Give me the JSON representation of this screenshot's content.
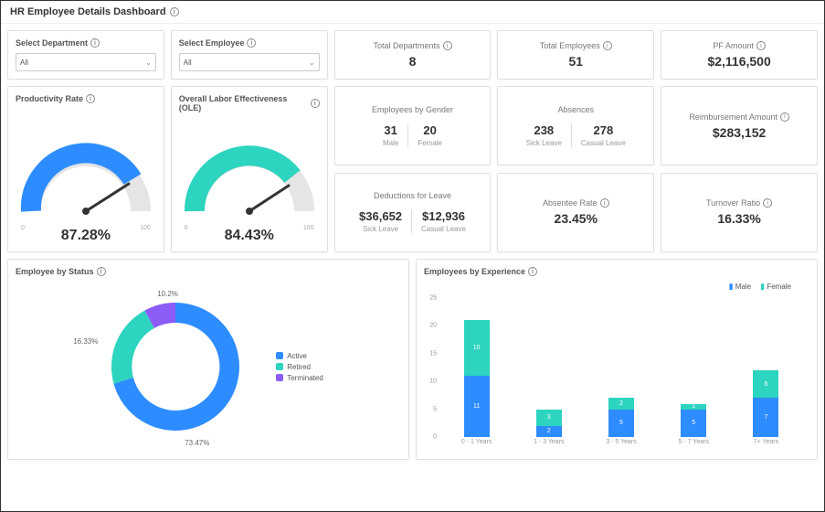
{
  "header": {
    "title": "HR Employee Details Dashboard"
  },
  "filters": {
    "department": {
      "label": "Select Department",
      "value": "All"
    },
    "employee": {
      "label": "Select Employee",
      "value": "All"
    }
  },
  "kpis": {
    "total_departments": {
      "label": "Total Departments",
      "value": "8"
    },
    "total_employees": {
      "label": "Total Employees",
      "value": "51"
    },
    "pf_amount": {
      "label": "PF Amount",
      "value": "$2,116,500"
    },
    "reimbursement": {
      "label": "Reimbursement Amount",
      "value": "$283,152"
    },
    "absentee_rate": {
      "label": "Absentee Rate",
      "value": "23.45%"
    },
    "turnover_ratio": {
      "label": "Turnover Ratio",
      "value": "16.33%"
    }
  },
  "gauges": {
    "productivity": {
      "title": "Productivity Rate",
      "value": "87.28%",
      "min": "0",
      "max": "100",
      "pct": 87.28,
      "color": "#2d8cff"
    },
    "ole": {
      "title": "Overall Labor Effectiveness (OLE)",
      "value": "84.43%",
      "min": "0",
      "max": "100",
      "pct": 84.43,
      "color": "#2dd4bf"
    }
  },
  "splits": {
    "gender": {
      "title": "Employees by Gender",
      "left_val": "31",
      "left_lab": "Male",
      "right_val": "20",
      "right_lab": "Female"
    },
    "absences": {
      "title": "Absences",
      "left_val": "238",
      "left_lab": "Sick Leave",
      "right_val": "278",
      "right_lab": "Casual Leave"
    },
    "deductions": {
      "title": "Deductions for Leave",
      "left_val": "$36,652",
      "left_lab": "Sick Leave",
      "right_val": "$12,936",
      "right_lab": "Casual Leave"
    }
  },
  "status_chart": {
    "title": "Employee by Status",
    "legend": {
      "active": "Active",
      "retired": "Retired",
      "terminated": "Terminated"
    },
    "labels": {
      "active": "73.47%",
      "retired": "16.33%",
      "terminated": "10.2%"
    }
  },
  "experience_chart": {
    "title": "Employees by Experience",
    "legend": {
      "male": "Male",
      "female": "Female"
    },
    "y_ticks": [
      "0",
      "5",
      "10",
      "15",
      "20",
      "25"
    ],
    "x_ticks": [
      "0 - 1 Years",
      "1 - 3 Years",
      "3 - 5 Years",
      "5 - 7 Years",
      "7+ Years"
    ]
  },
  "chart_data": [
    {
      "type": "gauge",
      "title": "Productivity Rate",
      "value": 87.28,
      "min": 0,
      "max": 100
    },
    {
      "type": "gauge",
      "title": "Overall Labor Effectiveness (OLE)",
      "value": 84.43,
      "min": 0,
      "max": 100
    },
    {
      "type": "pie",
      "title": "Employee by Status",
      "categories": [
        "Active",
        "Retired",
        "Terminated"
      ],
      "values": [
        73.47,
        16.33,
        10.2
      ],
      "colors": [
        "#2d8cff",
        "#2dd4bf",
        "#8b5cf6"
      ]
    },
    {
      "type": "bar",
      "title": "Employees by Experience",
      "categories": [
        "0 - 1 Years",
        "1 - 3 Years",
        "3 - 5 Years",
        "5 - 7 Years",
        "7+ Years"
      ],
      "series": [
        {
          "name": "Male",
          "values": [
            11,
            2,
            5,
            5,
            7
          ],
          "color": "#2d8cff"
        },
        {
          "name": "Female",
          "values": [
            10,
            3,
            2,
            1,
            5
          ],
          "color": "#2dd4bf"
        }
      ],
      "ylim": [
        0,
        25
      ],
      "xlabel": "",
      "ylabel": ""
    }
  ]
}
